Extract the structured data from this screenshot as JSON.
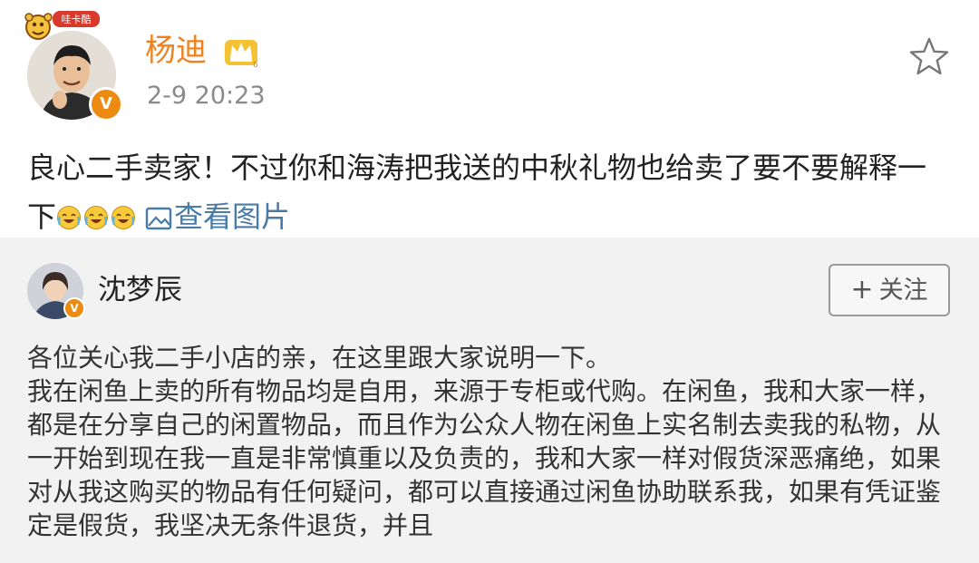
{
  "post": {
    "author": "杨迪",
    "badge_text": "哇卡酷",
    "time": "2-9 20:23",
    "text": "良心二手卖家！不过你和海涛把我送的中秋礼物也给卖了要不要解释一下",
    "emoji_icon": "laugh-cry-emoji",
    "emoji_count": 3,
    "view_image_label": "查看图片"
  },
  "repost": {
    "author": "沈梦辰",
    "follow_label": "关注",
    "paragraphs": [
      "各位关心我二手小店的亲，在这里跟大家说明一下。",
      "我在闲鱼上卖的所有物品均是自用，来源于专柜或代购。在闲鱼，我和大家一样，都是在分享自己的闲置物品，而且作为公众人物在闲鱼上实名制去卖我的私物，从一开始到现在我一直是非常慎重以及负责的，我和大家一样对假货深恶痛绝，如果对从我这购买的物品有任何疑问，都可以直接通过闲鱼协助联系我，如果有凭证鉴定是假货，我坚决无条件退货，并且"
    ]
  },
  "colors": {
    "author_orange": "#f0811f",
    "link_blue": "#4a7ba6",
    "verified_orange": "#ec8a11",
    "repost_bg": "#f2f2f2",
    "time_gray": "#8a8a8a"
  }
}
